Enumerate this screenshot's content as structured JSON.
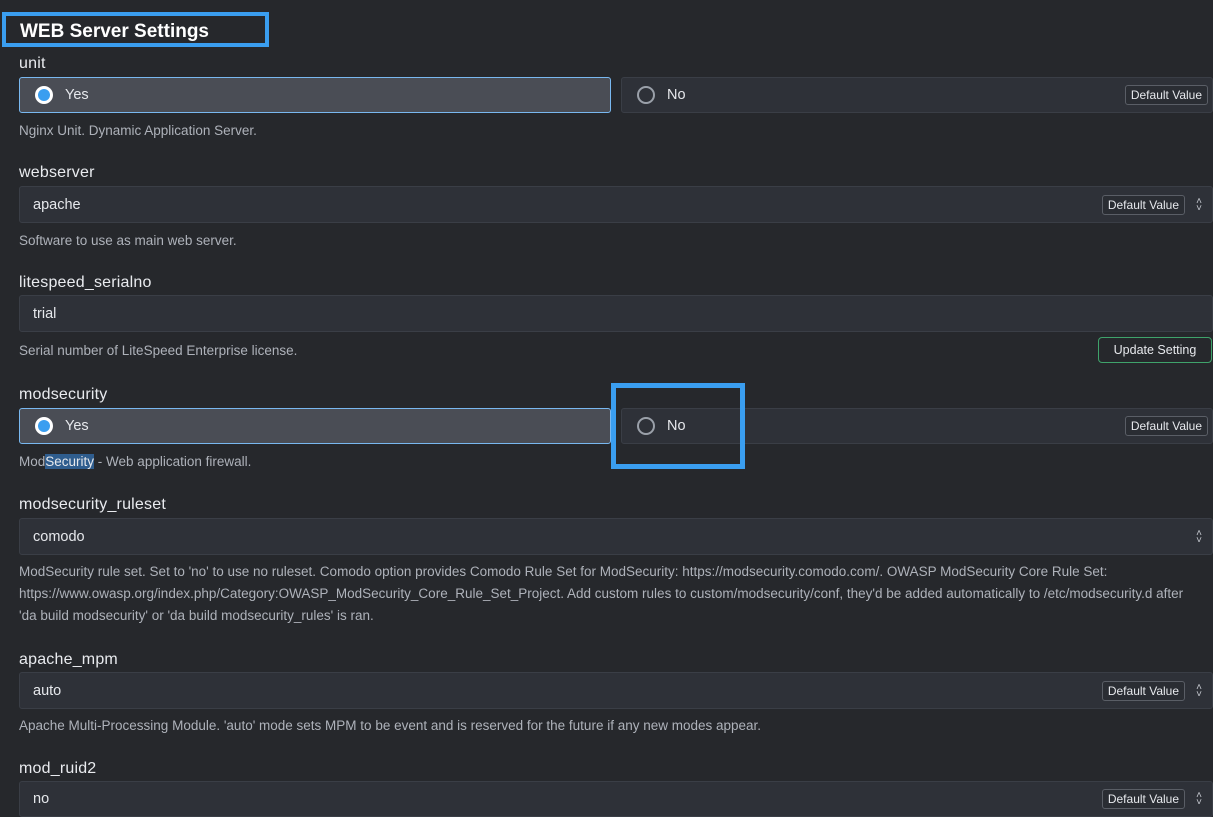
{
  "section": {
    "title": "WEB Server Settings"
  },
  "unit": {
    "label": "unit",
    "yes": "Yes",
    "no": "No",
    "default": "Default Value",
    "description": "Nginx Unit. Dynamic Application Server."
  },
  "webserver": {
    "label": "webserver",
    "value": "apache",
    "default": "Default Value",
    "description": "Software to use as main web server."
  },
  "litespeed": {
    "label": "litespeed_serialno",
    "value": "trial",
    "description": "Serial number of LiteSpeed Enterprise license.",
    "button": "Update Setting"
  },
  "modsecurity": {
    "label": "modsecurity",
    "yes": "Yes",
    "no": "No",
    "default": "Default Value",
    "desc_pre": "Mod",
    "desc_sel": "Security",
    "desc_post": " - Web application firewall."
  },
  "ruleset": {
    "label": "modsecurity_ruleset",
    "value": "comodo",
    "description": "ModSecurity rule set. Set to 'no' to use no ruleset. Comodo option provides Comodo Rule Set for ModSecurity: https://modsecurity.comodo.com/. OWASP ModSecurity Core Rule Set: https://www.owasp.org/index.php/Category:OWASP_ModSecurity_Core_Rule_Set_Project. Add custom rules to custom/modsecurity/conf, they'd be added automatically to /etc/modsecurity.d after 'da build modsecurity' or 'da build modsecurity_rules' is ran."
  },
  "apache_mpm": {
    "label": "apache_mpm",
    "value": "auto",
    "default": "Default Value",
    "description": "Apache Multi-Processing Module. 'auto' mode sets MPM to be event and is reserved for the future if any new modes appear."
  },
  "mod_ruid2": {
    "label": "mod_ruid2",
    "value": "no",
    "default": "Default Value"
  },
  "colors": {
    "accent": "#3a9ef0",
    "background": "#26282c",
    "button_border": "#3fa36b"
  }
}
